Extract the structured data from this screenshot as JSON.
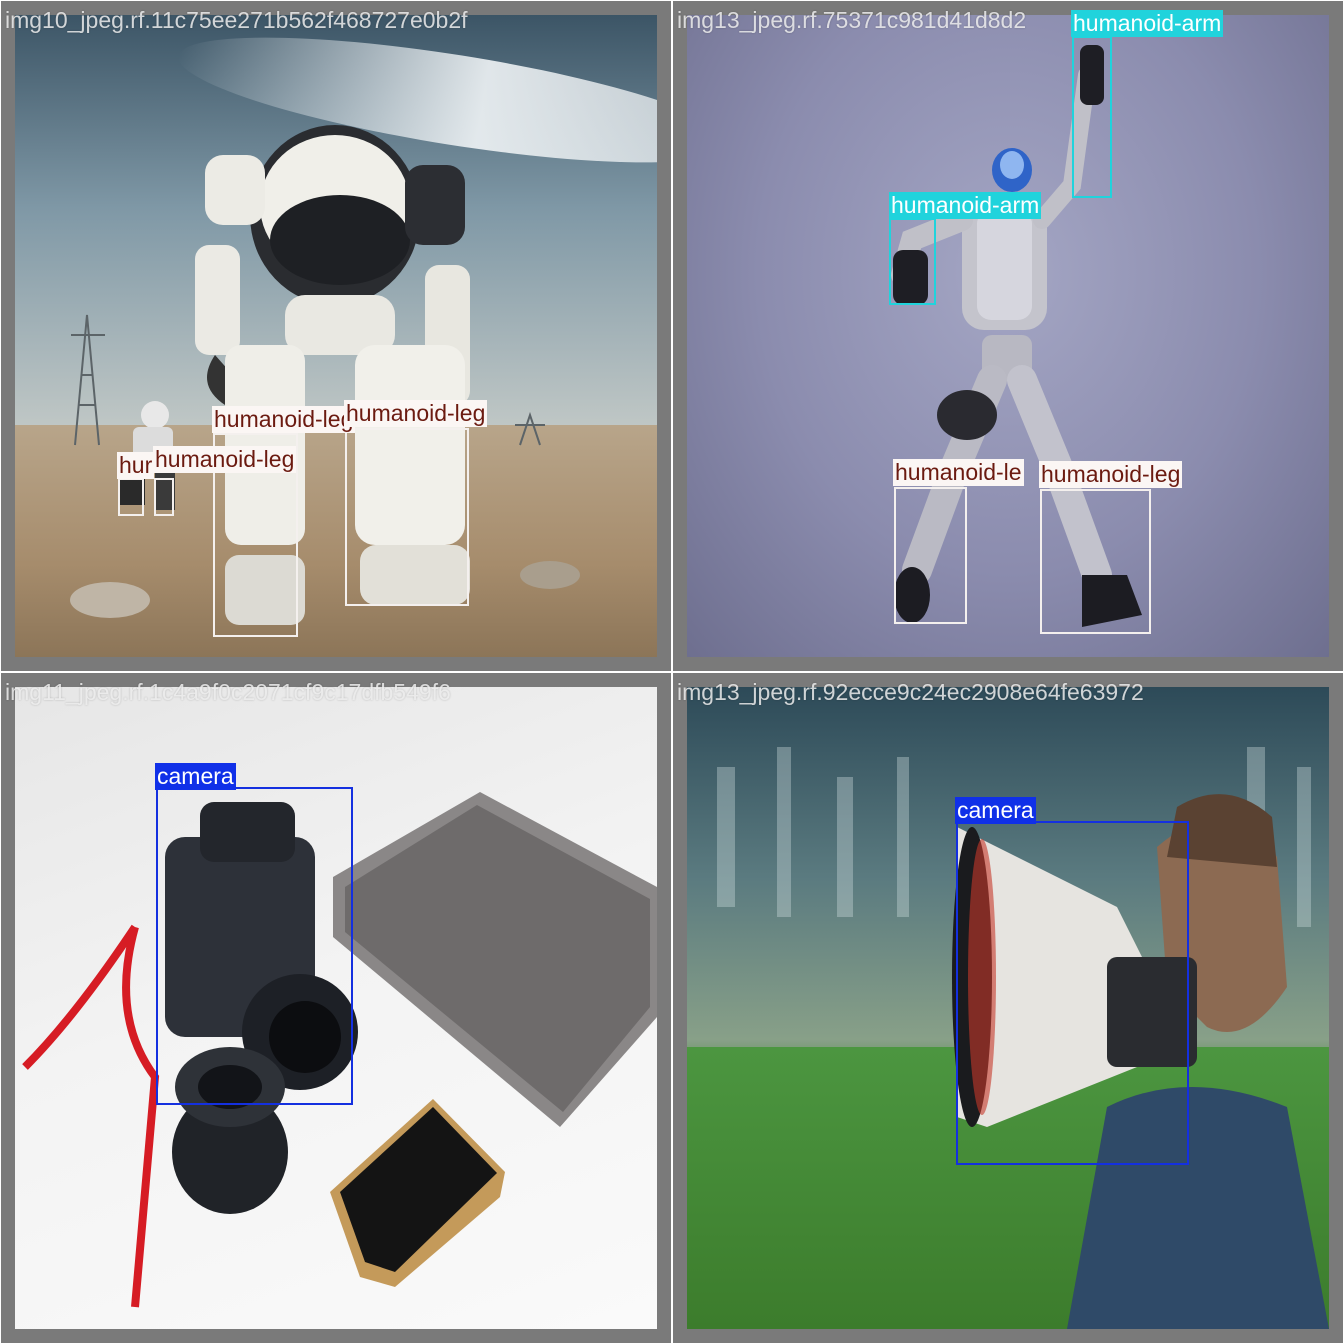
{
  "tiles": [
    {
      "filename": "img10_jpeg.rf.11c75ee271b562f468727e0b2f",
      "detections": [
        {
          "label": "humanoid-leg"
        },
        {
          "label": "humanoid-leg"
        },
        {
          "label": "hur"
        },
        {
          "label": "humanoid-leg"
        }
      ]
    },
    {
      "filename": "img13_jpeg.rf.75371c981d41d8d2",
      "detections": [
        {
          "label": "humanoid-arm"
        },
        {
          "label": "humanoid-arm"
        },
        {
          "label": "humanoid-le"
        },
        {
          "label": "humanoid-leg"
        }
      ]
    },
    {
      "filename": "img11_jpeg.rf.1c4a9f0c2071cf9c17dfb549f6",
      "detections": [
        {
          "label": "camera"
        }
      ]
    },
    {
      "filename": "img13_jpeg.rf.92ecce9c24ec2908e64fe63972",
      "detections": [
        {
          "label": "camera"
        }
      ]
    }
  ],
  "colors": {
    "humanoid-leg": "#f4f0ee",
    "humanoid-arm": "#20d3dc",
    "camera": "#1430e0",
    "tile_border": "#7a7a7a"
  }
}
